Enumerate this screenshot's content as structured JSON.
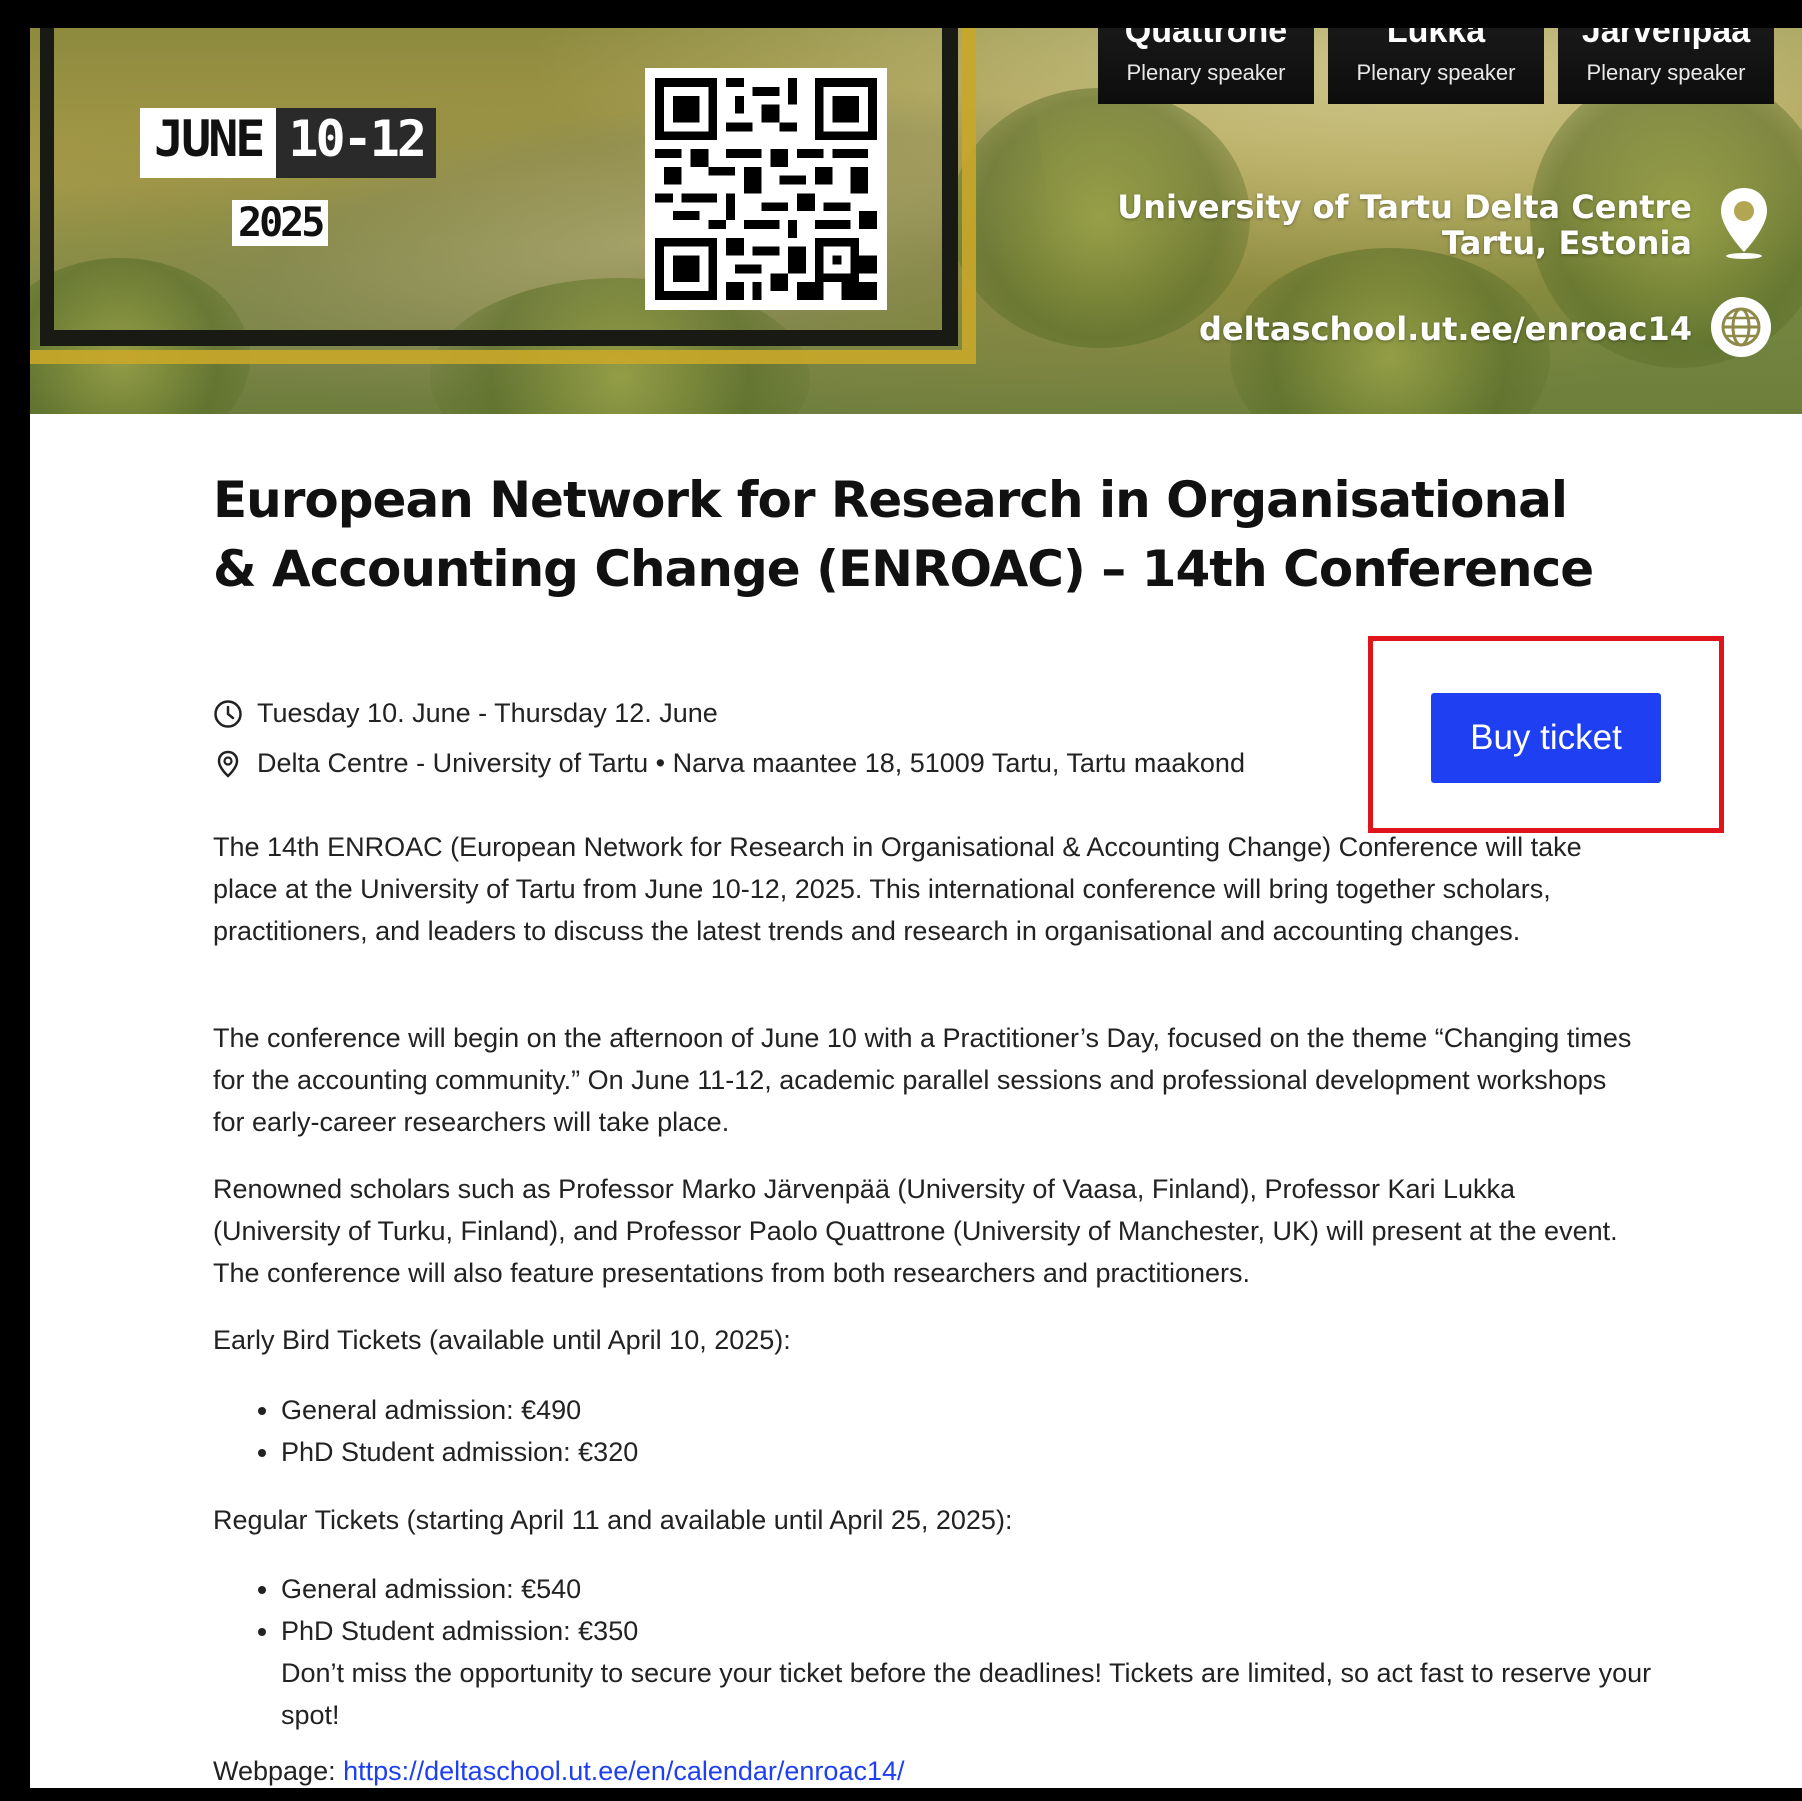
{
  "banner": {
    "date": {
      "month": "JUNE",
      "days": "10-12",
      "year": "2025"
    },
    "speakers": [
      {
        "name": "Quattrone",
        "role": "Plenary speaker"
      },
      {
        "name": "Lukka",
        "role": "Plenary speaker"
      },
      {
        "name": "Jarvenpaa",
        "role": "Plenary speaker"
      }
    ],
    "venue_line1": "University of Tartu Delta Centre",
    "venue_line2": "Tartu, Estonia",
    "website": "deltaschool.ut.ee/enroac14",
    "icons": [
      "qr-code",
      "location-pin-icon",
      "globe-icon"
    ]
  },
  "event": {
    "title": "European Network for Research in Organisational & Accounting Change (ENROAC) – 14th Conference",
    "date_range": "Tuesday 10. June - Thursday 12. June",
    "location": "Delta Centre - University of Tartu • Narva maantee 18, 51009 Tartu, Tartu maakond",
    "buy_label": "Buy ticket",
    "paragraphs": [
      "The 14th ENROAC (European Network for Research in Organisational & Accounting Change) Conference will take place at the University of Tartu from June 10-12, 2025. This international conference will bring together scholars, practitioners, and leaders to discuss the latest trends and research in organisational and accounting changes.",
      "The conference will begin on the afternoon of June 10 with a Practitioner’s Day, focused on the theme “Changing times for the accounting community.” On June 11-12, academic parallel sessions and professional development workshops for early-career researchers will take place.",
      "Renowned scholars such as Professor Marko Järvenpää (University of Vaasa, Finland), Professor Kari Lukka (University of Turku, Finland), and Professor Paolo Quattrone (University of Manchester, UK) will present at the event. The conference will also feature presentations from both researchers and practitioners."
    ],
    "early_bird": {
      "heading": "Early Bird Tickets (available until April 10, 2025):",
      "items": [
        "General admission: €490",
        "PhD Student admission: €320"
      ]
    },
    "regular": {
      "heading": "Regular Tickets (starting April 11 and available until April 25, 2025):",
      "items": [
        "General admission: €540",
        "PhD Student admission: €350"
      ],
      "note": "Don’t miss the opportunity to secure your ticket before the deadlines! Tickets are limited, so act fast to reserve your spot!"
    },
    "webpage_label": "Webpage: ",
    "webpage_url": "https://deltaschool.ut.ee/en/calendar/enroac14/"
  },
  "colors": {
    "accent": "#1f3ff2",
    "highlight": "#e0151c",
    "gold": "#c9a829"
  }
}
